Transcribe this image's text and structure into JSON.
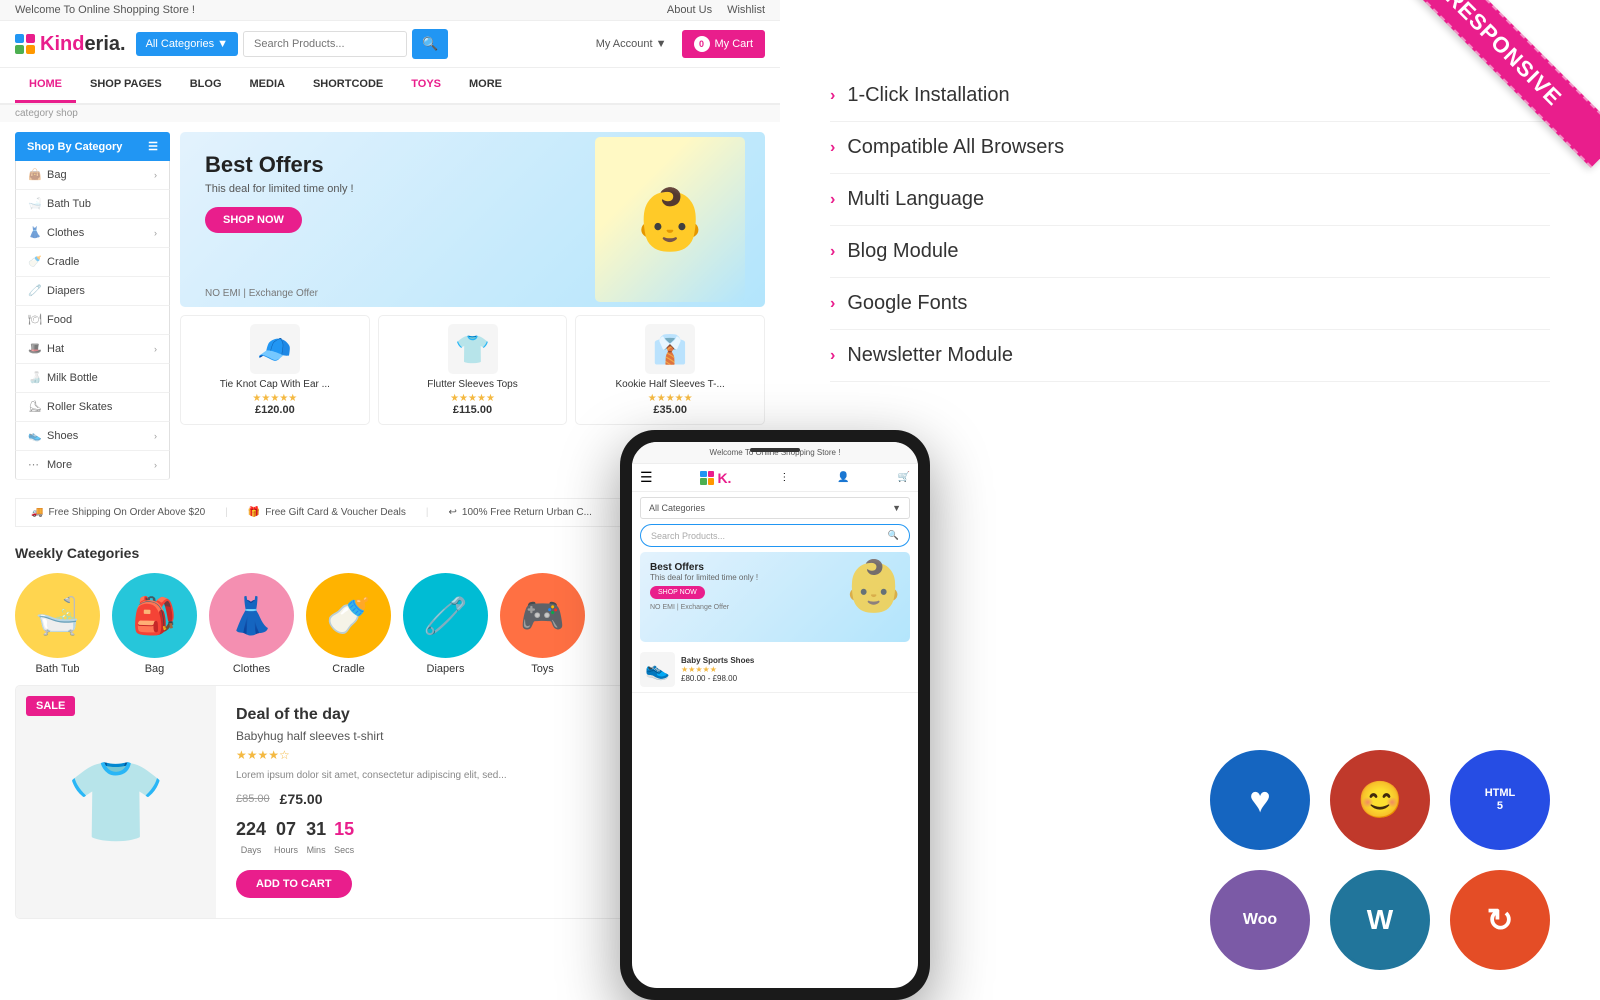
{
  "site": {
    "topbar": {
      "welcome": "Welcome To Online Shopping Store !",
      "about": "About Us",
      "wishlist": "Wishlist"
    },
    "header": {
      "logo_text": "Kind",
      "logo_suffix": "eria.",
      "category_dropdown": "All Categories",
      "search_placeholder": "Search Products...",
      "account_label": "My Account",
      "cart_label": "My Cart",
      "cart_count": "0"
    },
    "nav": {
      "items": [
        "HOME",
        "SHOP PAGES",
        "BLOG",
        "MEDIA",
        "SHORTCODE",
        "TOYS",
        "MORE"
      ]
    },
    "sidebar": {
      "title": "Shop By Category",
      "items": [
        {
          "name": "Bag",
          "has_arrow": true
        },
        {
          "name": "Bath Tub",
          "has_arrow": false
        },
        {
          "name": "Clothes",
          "has_arrow": true
        },
        {
          "name": "Cradle",
          "has_arrow": false
        },
        {
          "name": "Diapers",
          "has_arrow": false
        },
        {
          "name": "Food",
          "has_arrow": false
        },
        {
          "name": "Hat",
          "has_arrow": true
        },
        {
          "name": "Milk Bottle",
          "has_arrow": false
        },
        {
          "name": "Roller Skates",
          "has_arrow": false
        },
        {
          "name": "Shoes",
          "has_arrow": true
        },
        {
          "name": "More",
          "has_arrow": true
        }
      ]
    },
    "hero": {
      "title": "Best Offers",
      "subtitle": "This deal for limited time only !",
      "btn_label": "SHOP NOW",
      "badge": "NO EMI | Exchange Offer"
    },
    "products": [
      {
        "name": "Tie Knot Cap With Ear ...",
        "price": "£120.00",
        "icon": "🧢"
      },
      {
        "name": "Flutter Sleeves Tops",
        "price": "£115.00",
        "icon": "👕"
      },
      {
        "name": "Kookie Half Sleeves T-...",
        "price": "£35.00",
        "icon": "👔"
      }
    ],
    "features": [
      {
        "icon": "🚚",
        "text": "Free Shipping On Order Above $20"
      },
      {
        "icon": "🎁",
        "text": "Free Gift Card & Voucher Deals"
      },
      {
        "icon": "↩",
        "text": "100% Free Return Urban C..."
      }
    ],
    "weekly_categories": {
      "title": "Weekly Categories",
      "items": [
        {
          "name": "Bath Tub",
          "icon": "🛁",
          "color": "hex-yellow"
        },
        {
          "name": "Bag",
          "icon": "🎒",
          "color": "hex-teal"
        },
        {
          "name": "Clothes",
          "icon": "👗",
          "color": "hex-pink"
        },
        {
          "name": "Cradle",
          "icon": "🍼",
          "color": "hex-gold"
        },
        {
          "name": "Diapers",
          "icon": "🧷",
          "color": "hex-cyan"
        },
        {
          "name": "...",
          "icon": "🎮",
          "color": "hex-orange"
        }
      ]
    },
    "deal": {
      "badge": "SALE",
      "title": "Deal of the day",
      "product": "Babyhug half sleeves t-shirt",
      "old_price": "£85.00",
      "new_price": "£75.00",
      "desc": "Lorem ipsum dolor sit amet, consectetur adipiscing elit, sed...",
      "btn": "ADD TO CART",
      "countdown": {
        "days": "224",
        "hours": "07",
        "mins": "31",
        "secs": "15"
      }
    }
  },
  "phone": {
    "top_text": "Welcome To Online Shopping Store !",
    "logo": "K.",
    "categories_label": "All Categories",
    "search_placeholder": "Search Products...",
    "hero_title": "Best Offers",
    "hero_subtitle": "This deal for limited time only !",
    "hero_btn": "SHOP NOW",
    "hero_emi": "NO EMI | Exchange Offer",
    "product_name": "Baby Sports Shoes",
    "product_price": "£80.00 - £98.00"
  },
  "features_list": {
    "items": [
      "1-Click Installation",
      "Compatible All Browsers",
      "Multi Language",
      "Blog Module",
      "Google Fonts",
      "Newsletter Module"
    ]
  },
  "responsive_label": "RESPONSIVE",
  "tech_icons": [
    {
      "label": "♥",
      "class": "icon-heart",
      "title": "Love"
    },
    {
      "label": "😊",
      "class": "icon-face",
      "title": "Face"
    },
    {
      "label": "HTML5",
      "class": "icon-html5",
      "title": "HTML5"
    },
    {
      "label": "Woo",
      "class": "icon-woo",
      "title": "WooCommerce"
    },
    {
      "label": "WP",
      "class": "icon-wordpress",
      "title": "WordPress"
    },
    {
      "label": "↻",
      "class": "icon-refresh",
      "title": "Refresh"
    }
  ],
  "category_shop_label": "category shop"
}
